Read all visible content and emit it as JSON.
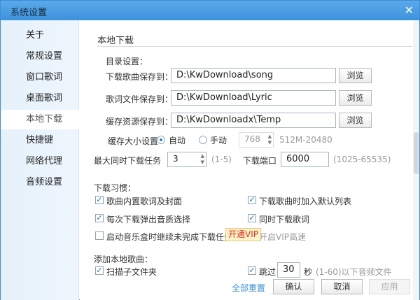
{
  "window": {
    "title": "系统设置",
    "close": "✕"
  },
  "sidebar": {
    "items": [
      {
        "label": "关于"
      },
      {
        "label": "常规设置"
      },
      {
        "label": "窗口歌词"
      },
      {
        "label": "桌面歌词"
      },
      {
        "label": "本地下载"
      },
      {
        "label": "快捷键"
      },
      {
        "label": "网络代理"
      },
      {
        "label": "音频设置"
      }
    ],
    "selected": "本地下载"
  },
  "main": {
    "title": "本地下载",
    "dir_section": "目录设置：",
    "dirs": [
      {
        "label": "下载歌曲保存到：",
        "value": "D:\\KwDownload\\song",
        "button": "浏览"
      },
      {
        "label": "歌词文件保存到：",
        "value": "D:\\KwDownload\\Lyric",
        "button": "浏览"
      },
      {
        "label": "缓存资源保存到：",
        "value": "D:\\KwDownloadx\\Temp",
        "button": "浏览"
      }
    ],
    "cache": {
      "label": "缓存大小设置",
      "auto": "自动",
      "manual": "手动",
      "value": "768",
      "range": "512M-20480"
    },
    "tasks": {
      "label": "最大同时下载任务",
      "value": "3",
      "range": "(1-5)"
    },
    "port": {
      "label": "下载端口",
      "value": "6000",
      "range": "(1025-65535)"
    },
    "habits_title": "下载习惯：",
    "habits": [
      {
        "label": "歌曲内置歌词及封面",
        "checked": true
      },
      {
        "label": "下载歌曲时加入默认列表",
        "checked": true
      },
      {
        "label": "每次下载弹出音质选择",
        "checked": true
      },
      {
        "label": "同时下载歌词",
        "checked": true
      },
      {
        "label": "启动音乐盒时继续未完成下载任务",
        "checked": false
      },
      {
        "label": "开启VIP高速",
        "checked": false
      }
    ],
    "vip_button": "开通VIP",
    "add_title": "添加本地歌曲：",
    "scan": {
      "label": "扫描子文件夹",
      "checked": true
    },
    "skip": {
      "label": "跳过",
      "value": "30",
      "unit": "秒",
      "hint": "(1-60)以下音频文件",
      "checked": true
    }
  },
  "footer": {
    "reset": "全部重置",
    "ok": "确认",
    "cancel": "取消",
    "apply": "应用"
  }
}
